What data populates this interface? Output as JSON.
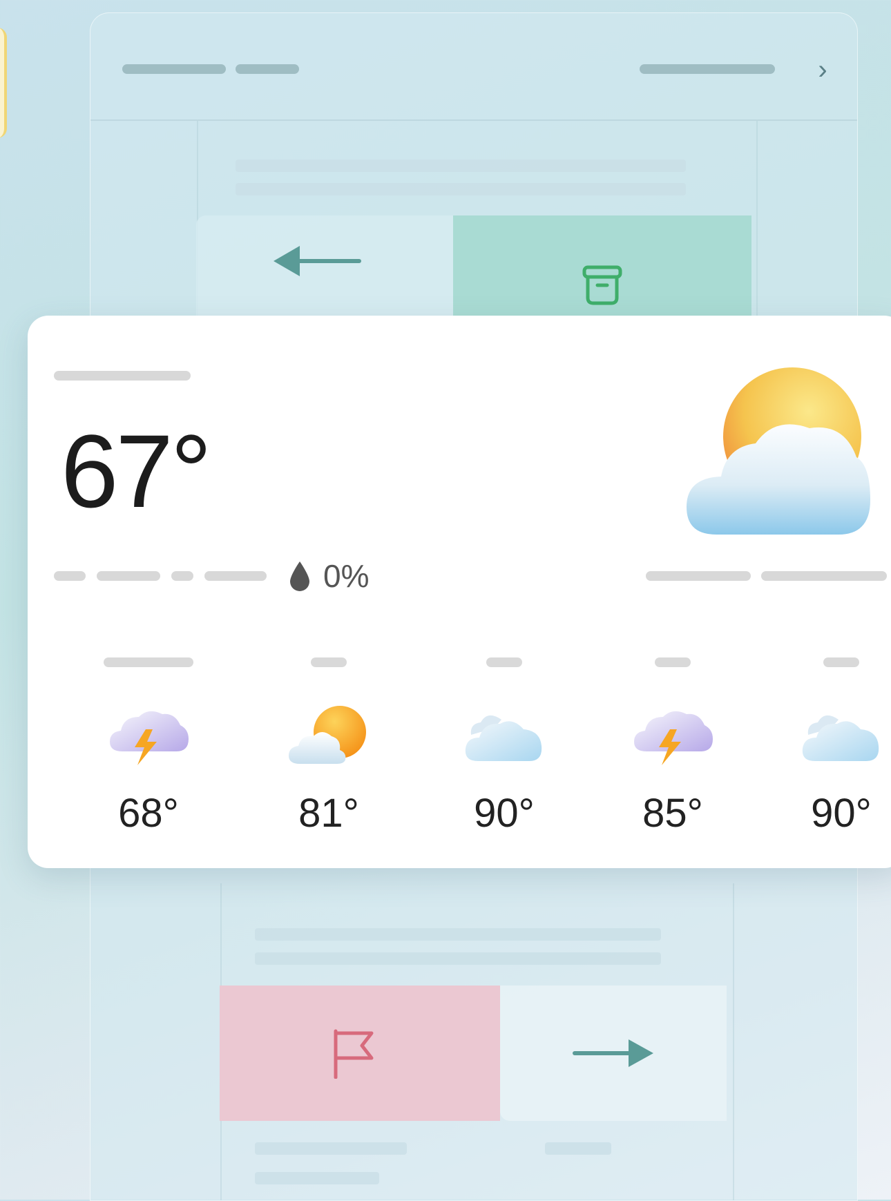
{
  "weather": {
    "current_temp": "67°",
    "precipitation": "0%",
    "condition_icon": "sun-behind-cloud-icon",
    "forecast": [
      {
        "temp": "68°",
        "icon": "thunderstorm-icon"
      },
      {
        "temp": "81°",
        "icon": "sun-behind-cloud-icon"
      },
      {
        "temp": "90°",
        "icon": "cloud-icon"
      },
      {
        "temp": "85°",
        "icon": "thunderstorm-icon"
      },
      {
        "temp": "90°",
        "icon": "cloud-icon"
      }
    ]
  },
  "background": {
    "header_chevron": "›",
    "actions": {
      "reply_icon": "arrow-left-icon",
      "archive_icon": "archive-icon",
      "flag_icon": "flag-icon",
      "forward_icon": "arrow-right-icon"
    },
    "colors": {
      "archive": "#a9dbd3",
      "flag": "#ebc8d2",
      "arrow": "#5a9b97"
    }
  }
}
